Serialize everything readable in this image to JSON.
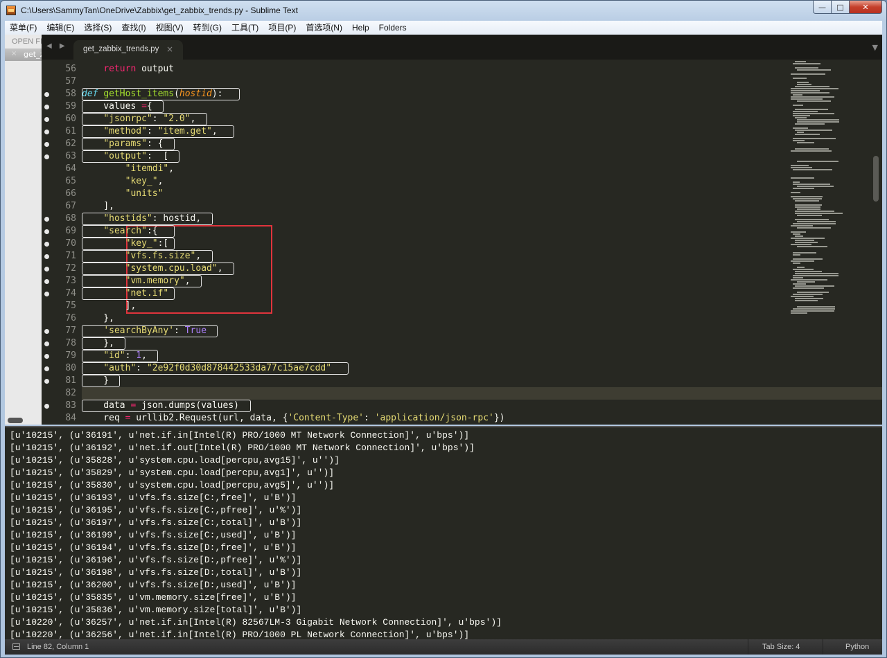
{
  "window": {
    "title": "C:\\Users\\SammyTan\\OneDrive\\Zabbix\\get_zabbix_trends.py - Sublime Text",
    "controls": {
      "minimize": "—",
      "maximize": "□",
      "close": "✕"
    }
  },
  "menu": [
    "菜单(F)",
    "编辑(E)",
    "选择(S)",
    "查找(I)",
    "视图(V)",
    "转到(G)",
    "工具(T)",
    "项目(P)",
    "首选项(N)",
    "Help",
    "Folders"
  ],
  "sidebar": {
    "header": "OPEN FILES",
    "files": [
      {
        "close": "×",
        "name": "get_zabbix_trends.py"
      }
    ]
  },
  "tabs": {
    "nav": "◀ ▶",
    "active": {
      "label": "get_zabbix_trends.py",
      "close": "×"
    },
    "dropdown": "▼"
  },
  "editor": {
    "current_line": 82,
    "lines": [
      {
        "n": "56",
        "dot": false,
        "html": "    <span class='k'>return</span> output"
      },
      {
        "n": "57",
        "dot": false,
        "html": ""
      },
      {
        "n": "58",
        "dot": true,
        "html": "<span class='d'>def</span> <span class='f'>getHost_items</span>(<span class='p'>hostid</span>):"
      },
      {
        "n": "59",
        "dot": true,
        "html": "    values <span class='k'>=</span>{"
      },
      {
        "n": "60",
        "dot": true,
        "html": "    <span class='s'>\"jsonrpc\"</span>: <span class='s'>\"2.0\"</span>,"
      },
      {
        "n": "61",
        "dot": true,
        "html": "    <span class='s'>\"method\"</span>: <span class='s'>\"item.get\"</span>,"
      },
      {
        "n": "62",
        "dot": true,
        "html": "    <span class='s'>\"params\"</span>: {"
      },
      {
        "n": "63",
        "dot": true,
        "html": "    <span class='s'>\"output\"</span>:  ["
      },
      {
        "n": "64",
        "dot": false,
        "html": "        <span class='s'>\"itemdi\"</span>,"
      },
      {
        "n": "65",
        "dot": false,
        "html": "        <span class='s'>\"key_\"</span>,"
      },
      {
        "n": "66",
        "dot": false,
        "html": "        <span class='s'>\"units\"</span>"
      },
      {
        "n": "67",
        "dot": false,
        "html": "    ],"
      },
      {
        "n": "68",
        "dot": true,
        "html": "    <span class='s'>\"hostids\"</span>: hostid,"
      },
      {
        "n": "69",
        "dot": true,
        "html": "    <span class='s'>\"search\"</span>:{"
      },
      {
        "n": "70",
        "dot": true,
        "html": "        <span class='s'>\"key_\"</span>:["
      },
      {
        "n": "71",
        "dot": true,
        "html": "        <span class='s'>\"vfs.fs.size\"</span>,"
      },
      {
        "n": "72",
        "dot": true,
        "html": "        <span class='s'>\"system.cpu.load\"</span>,"
      },
      {
        "n": "73",
        "dot": true,
        "html": "        <span class='s'>\"vm.memory\"</span>,"
      },
      {
        "n": "74",
        "dot": true,
        "html": "        <span class='s'>\"net.if\"</span>"
      },
      {
        "n": "75",
        "dot": false,
        "html": "        ],"
      },
      {
        "n": "76",
        "dot": false,
        "html": "    },"
      },
      {
        "n": "77",
        "dot": true,
        "html": "    <span class='s'>'searchByAny'</span>: <span class='c'>True</span>"
      },
      {
        "n": "78",
        "dot": true,
        "html": "    },"
      },
      {
        "n": "79",
        "dot": true,
        "html": "    <span class='s'>\"id\"</span>: <span class='c'>1</span>,"
      },
      {
        "n": "80",
        "dot": true,
        "html": "    <span class='s'>\"auth\"</span>: <span class='s'>\"2e92f0d30d878442533da77c15ae7cdd\"</span>"
      },
      {
        "n": "81",
        "dot": true,
        "html": "    }"
      },
      {
        "n": "82",
        "dot": false,
        "html": ""
      },
      {
        "n": "83",
        "dot": true,
        "html": "    data <span class='k'>=</span> json.dumps(values)"
      },
      {
        "n": "84",
        "dot": false,
        "html": "    req <span class='k'>=</span> urllib2.Request(url, data, {<span class='s'>'Content-Type'</span>: <span class='s'>'application/json-rpc'</span>})"
      }
    ]
  },
  "console": {
    "lines": [
      "[u'10215', (u'36191', u'net.if.in[Intel(R) PRO/1000 MT Network Connection]', u'bps')]",
      "[u'10215', (u'36192', u'net.if.out[Intel(R) PRO/1000 MT Network Connection]', u'bps')]",
      "[u'10215', (u'35828', u'system.cpu.load[percpu,avg15]', u'')]",
      "[u'10215', (u'35829', u'system.cpu.load[percpu,avg1]', u'')]",
      "[u'10215', (u'35830', u'system.cpu.load[percpu,avg5]', u'')]",
      "[u'10215', (u'36193', u'vfs.fs.size[C:,free]', u'B')]",
      "[u'10215', (u'36195', u'vfs.fs.size[C:,pfree]', u'%')]",
      "[u'10215', (u'36197', u'vfs.fs.size[C:,total]', u'B')]",
      "[u'10215', (u'36199', u'vfs.fs.size[C:,used]', u'B')]",
      "[u'10215', (u'36194', u'vfs.fs.size[D:,free]', u'B')]",
      "[u'10215', (u'36196', u'vfs.fs.size[D:,pfree]', u'%')]",
      "[u'10215', (u'36198', u'vfs.fs.size[D:,total]', u'B')]",
      "[u'10215', (u'36200', u'vfs.fs.size[D:,used]', u'B')]",
      "[u'10215', (u'35835', u'vm.memory.size[free]', u'B')]",
      "[u'10215', (u'35836', u'vm.memory.size[total]', u'B')]",
      "[u'10220', (u'36257', u'net.if.in[Intel(R) 82567LM-3 Gigabit Network Connection]', u'bps')]",
      "[u'10220', (u'36256', u'net.if.in[Intel(R) PRO/1000 PL Network Connection]', u'bps')]"
    ]
  },
  "status": {
    "position": "Line 82, Column 1",
    "tab_size": "Tab Size: 4",
    "syntax": "Python"
  },
  "colors": {
    "editor_bg": "#272822",
    "keyword": "#f92672",
    "string": "#e6db74",
    "function": "#a6e22e",
    "annotation_box": "#e1343c"
  }
}
